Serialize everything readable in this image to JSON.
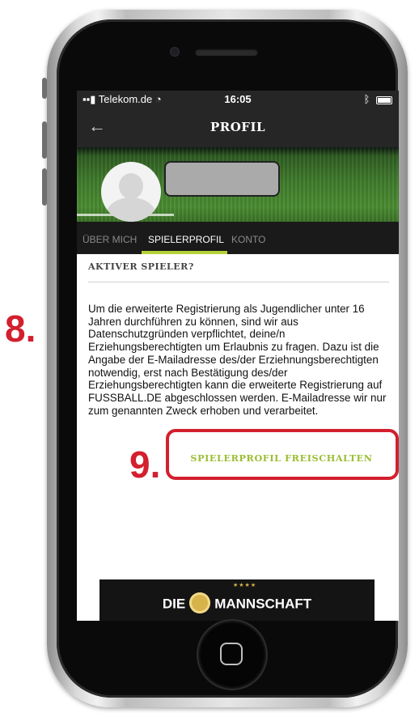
{
  "status_bar": {
    "carrier": "Telekom.de",
    "time": "16:05"
  },
  "header": {
    "back_icon": "←",
    "title": "PROFIL"
  },
  "tabs": [
    {
      "label": "ÜBER MICH"
    },
    {
      "label": "SPIELERPROFIL"
    },
    {
      "label": "KONTO"
    }
  ],
  "active_tab": "SPIELERPROFIL",
  "section": {
    "title": "AKTIVER SPIELER?",
    "body": "Um die erweiterte Registrierung als Jugendlicher unter 16 Jahren durchführen zu können, sind wir aus Datenschutzgründen verpflichtet, deine/n Erziehungsberechtigten um Erlaubnis zu fragen. Dazu ist die Angabe der E-Mailadresse des/der Erziehnungsberechtigten notwendig, erst nach Bestätigung des/der Erziehungsberechtigten kann die erweiterte Registrierung auf FUSSBALL.DE abgeschlossen werden. E-Mailadresse wir nur zum genannten Zweck erhoben und verarbeitet."
  },
  "unlock_button": {
    "label": "SPIELERPROFIL FREISCHALTEN"
  },
  "ad": {
    "left_text": "DIE",
    "right_text": "MANNSCHAFT",
    "stars": "★★★★"
  },
  "annotations": {
    "step_8": "8.",
    "step_9": "9."
  },
  "colors": {
    "accent": "#9bbd34",
    "annotation_red": "#d31f2e",
    "header_bg": "#262626"
  }
}
